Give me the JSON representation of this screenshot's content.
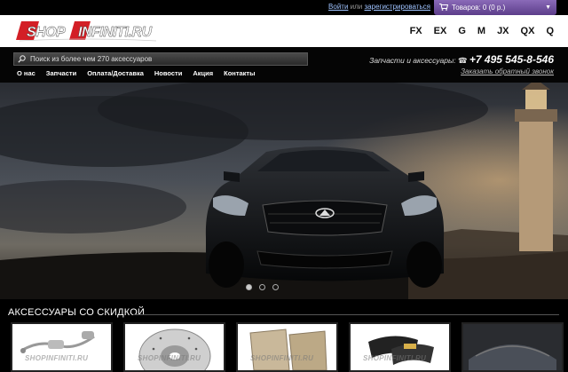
{
  "auth": {
    "login": "Войти",
    "or": "или",
    "register": "зарегистрироваться"
  },
  "cart": {
    "label": "Товаров: 0 (0 р.)"
  },
  "logo": {
    "text": "SHOPINFINITI.RU"
  },
  "models": [
    "FX",
    "EX",
    "G",
    "M",
    "JX",
    "QX",
    "Q"
  ],
  "search": {
    "placeholder": "Поиск из более чем 270 аксессуаров"
  },
  "menu": [
    "О нас",
    "Запчасти",
    "Оплата/Доставка",
    "Новости",
    "Акция",
    "Контакты"
  ],
  "contact": {
    "text": "Запчасти и аксессуары:",
    "phone": "+7 495 545-8-546",
    "callback": "Заказать обратный звонок"
  },
  "slider": {
    "count": 3,
    "active": 0
  },
  "section": {
    "title": "АКСЕССУАРЫ СО СКИДКОЙ"
  },
  "products": [
    {
      "name": "exhaust"
    },
    {
      "name": "brake-disc"
    },
    {
      "name": "floor-mats"
    },
    {
      "name": "brake-pads"
    },
    {
      "name": "car-interior"
    }
  ],
  "watermark": "SHOPINFINITI.RU",
  "colors": {
    "cart": "#6b4a9b",
    "link": "#9fc3ff",
    "logo_red": "#d31f26"
  }
}
